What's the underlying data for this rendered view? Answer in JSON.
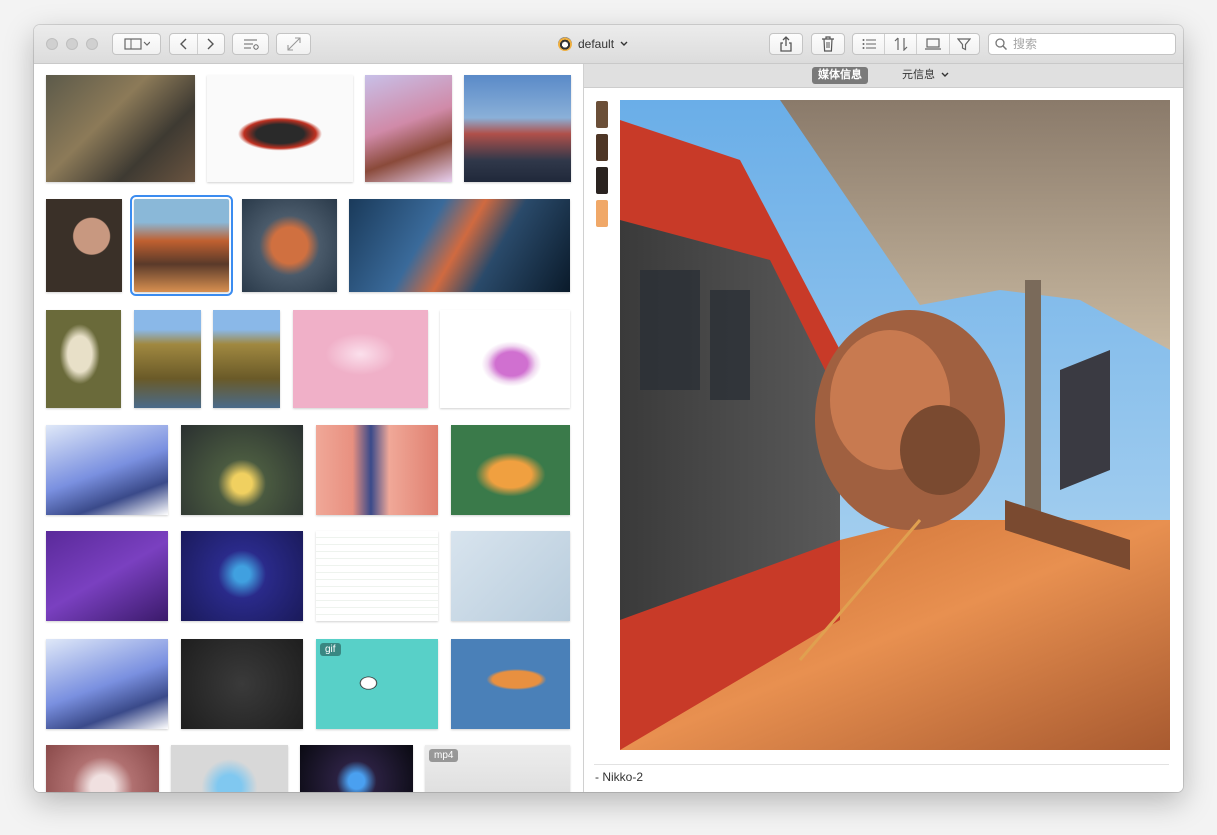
{
  "toolbar": {
    "library_name": "default",
    "search_placeholder": "搜索"
  },
  "inspector": {
    "tab_media_info": "媒体信息",
    "tab_meta_info": "元信息",
    "colors": [
      "#6b4f38",
      "#4e3626",
      "#2a2320",
      "#f0a868"
    ],
    "caption": "- Nikko-2"
  },
  "grid": {
    "badges": {
      "gif": "gif",
      "mp4": "mp4"
    }
  }
}
